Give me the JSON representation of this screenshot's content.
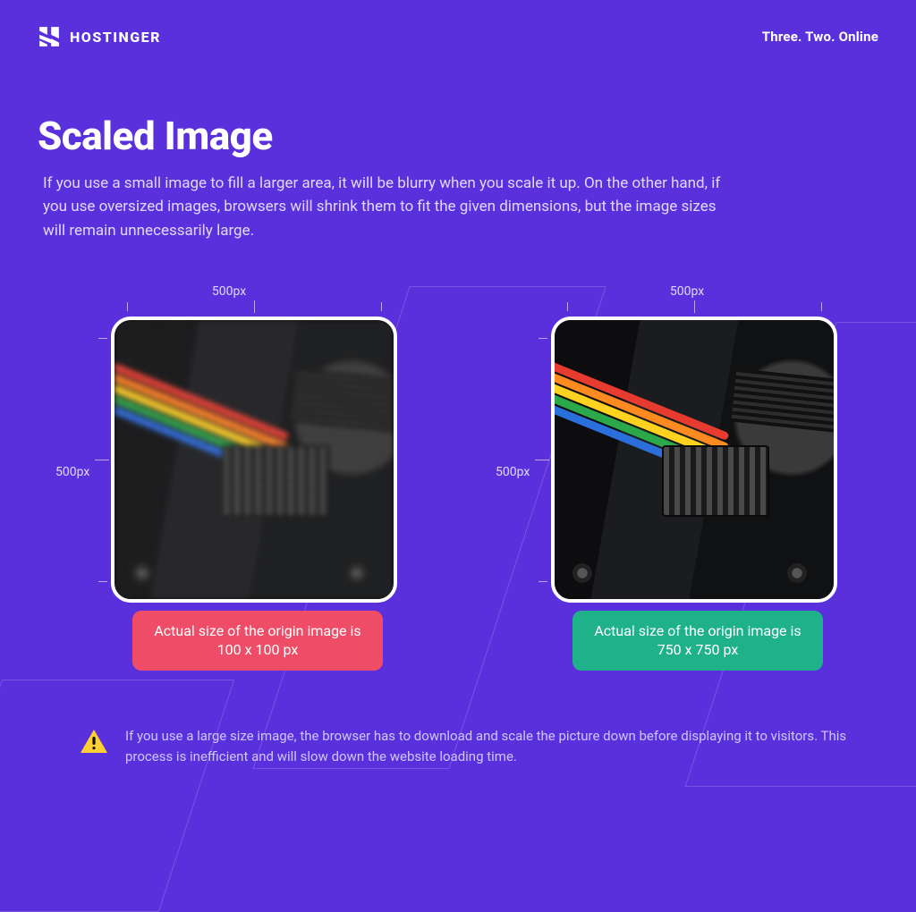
{
  "brand": {
    "name": "HOSTINGER",
    "tagline": "Three. Two. Online"
  },
  "page": {
    "title": "Scaled Image",
    "body": "If you use a small image to fill a larger area, it will be blurry when you scale it up. On the other hand, if you use oversized images, browsers will shrink them to fit the given dimensions, but the image sizes will remain unnecessarily large."
  },
  "panels": {
    "left": {
      "width_label": "500px",
      "height_label": "500px",
      "caption": "Actual size of the origin image is 100 x 100 px"
    },
    "right": {
      "width_label": "500px",
      "height_label": "500px",
      "caption": "Actual size of the origin image is 750 x 750 px"
    }
  },
  "warning": "If you use a large size image, the browser has to download and scale the picture down before displaying it to visitors. This process is inefficient and will slow down the website loading time."
}
